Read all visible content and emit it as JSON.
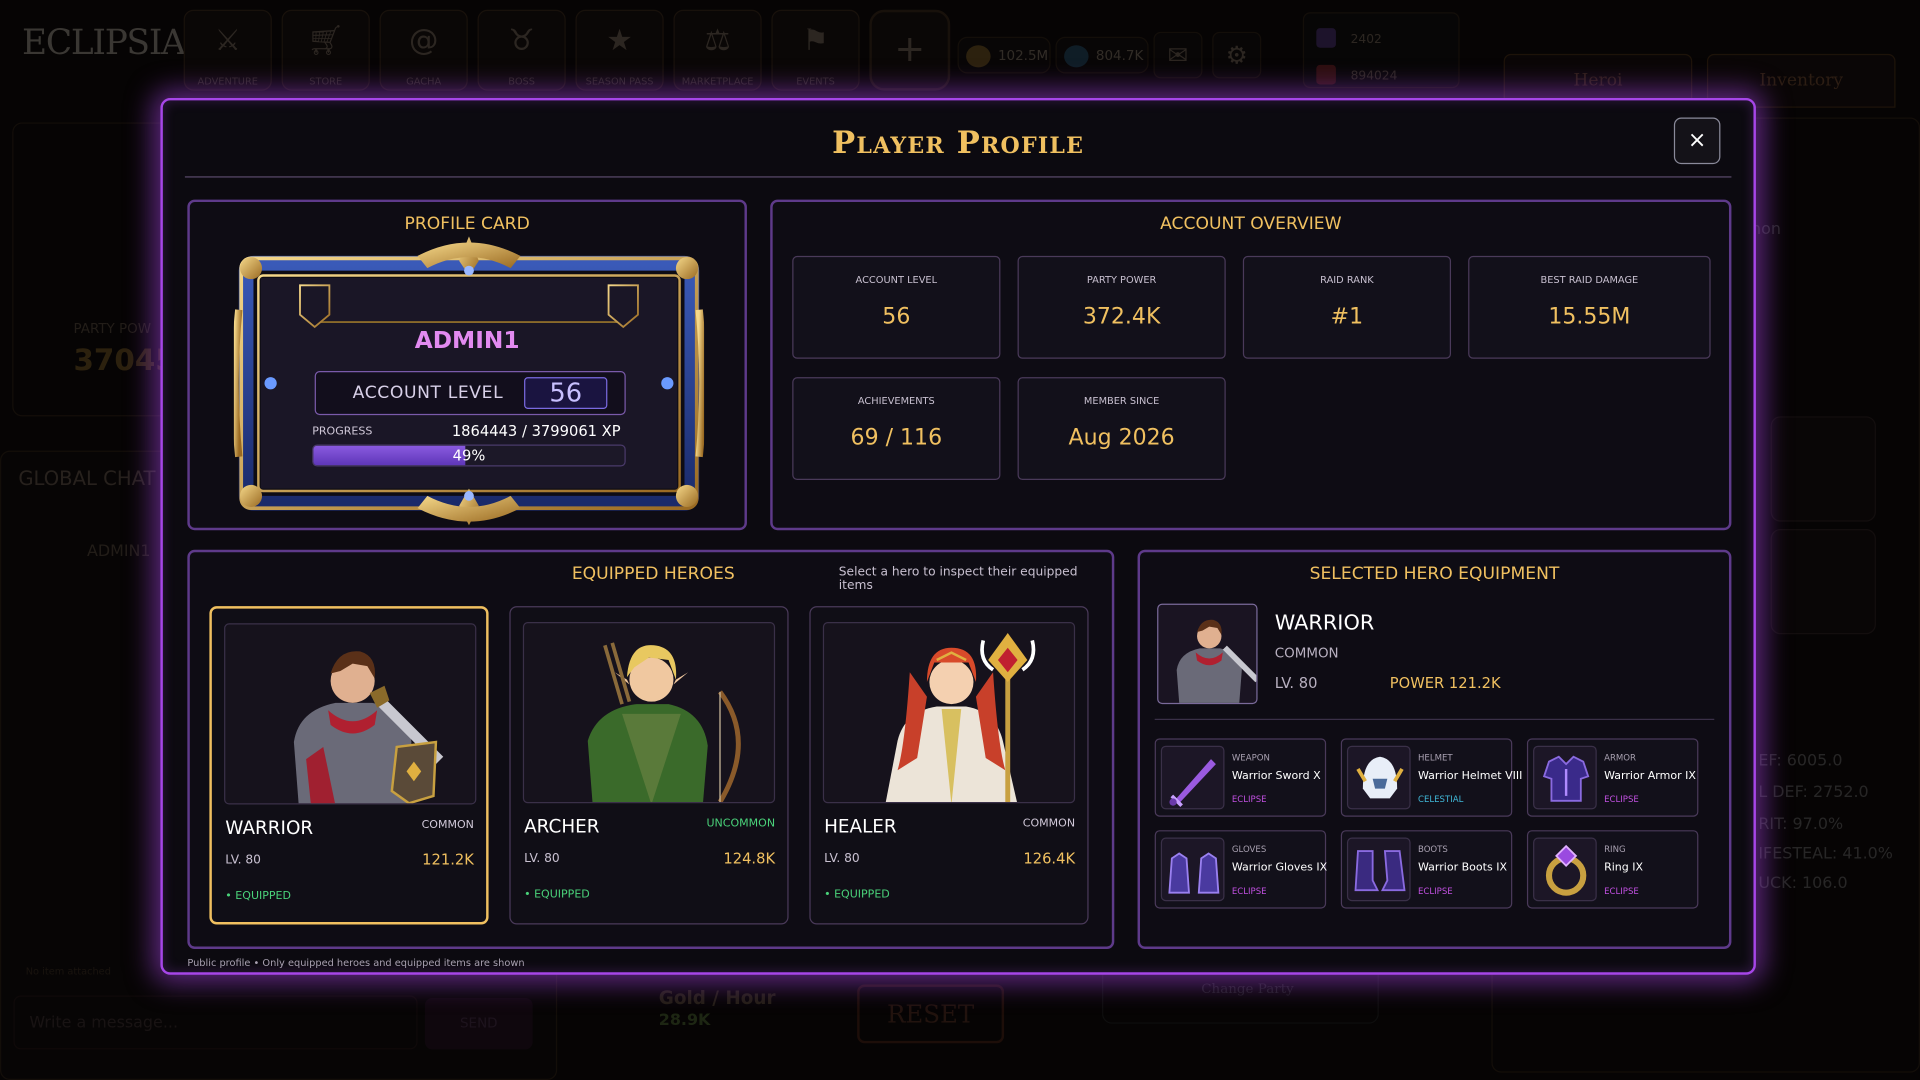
{
  "background": {
    "logo": "ECLIPSIA",
    "nav": [
      {
        "label": "ADVENTURE",
        "icon": "crossed-swords-icon"
      },
      {
        "label": "STORE",
        "icon": "cart-icon"
      },
      {
        "label": "GACHA",
        "icon": "swirl-icon"
      },
      {
        "label": "BOSS",
        "icon": "horned-helmet-icon"
      },
      {
        "label": "SEASON PASS",
        "icon": "star-shield-icon"
      },
      {
        "label": "MARKETPLACE",
        "icon": "scales-icon"
      },
      {
        "label": "EVENTS",
        "icon": "banner-icon"
      }
    ],
    "plus": "+",
    "gold": "102.5M",
    "fish": "804.7K",
    "gems": "2402",
    "rubies": "894024",
    "tab_heroes": "Heroi",
    "tab_inventory": "Inventory",
    "party_power_label": "PARTY POW",
    "party_power_value": "37045",
    "chat_title": "GLOBAL CHAT",
    "chat_user": "ADMIN1",
    "chat_attach": "No item attached",
    "chat_placeholder": "Write a message...",
    "chat_send": "SEND",
    "gold_hour_label": "Gold / Hour",
    "gold_hour_value": "28.9K",
    "reset": "RESET",
    "change_party": "Change Party",
    "stats": [
      "EF: 6005.0",
      "L DEF: 2752.0",
      "RIT: 97.0%",
      "IFESTEAL: 41.0%",
      "UCK: 106.0"
    ],
    "summon_frag": "non"
  },
  "modal": {
    "title": "Player Profile",
    "close": "×",
    "footnote": "Public profile • Only equipped heroes and equipped items are shown"
  },
  "profile_card": {
    "title": "PROFILE CARD",
    "name": "ADMIN1",
    "level_label": "ACCOUNT LEVEL",
    "level": "56",
    "progress_label": "PROGRESS",
    "progress_xp": "1864443 / 3799061 XP",
    "progress_pct_text": "49%",
    "progress_fraction": 0.49
  },
  "overview": {
    "title": "ACCOUNT OVERVIEW",
    "stats": [
      {
        "label": "ACCOUNT LEVEL",
        "value": "56"
      },
      {
        "label": "PARTY POWER",
        "value": "372.4K"
      },
      {
        "label": "RAID RANK",
        "value": "#1"
      },
      {
        "label": "BEST RAID DAMAGE",
        "value": "15.55M"
      },
      {
        "label": "ACHIEVEMENTS",
        "value": "69 / 116"
      },
      {
        "label": "MEMBER SINCE",
        "value": "Aug 2026"
      }
    ]
  },
  "heroes": {
    "title": "EQUIPPED HEROES",
    "subtitle": "Select a hero to inspect their equipped items",
    "list": [
      {
        "name": "WARRIOR",
        "rarity": "COMMON",
        "rarity_color": "#d0c8d8",
        "level": "LV. 80",
        "power": "121.2K",
        "status": "• EQUIPPED"
      },
      {
        "name": "ARCHER",
        "rarity": "UNCOMMON",
        "rarity_color": "#4ad27a",
        "level": "LV. 80",
        "power": "124.8K",
        "status": "• EQUIPPED"
      },
      {
        "name": "HEALER",
        "rarity": "COMMON",
        "rarity_color": "#d0c8d8",
        "level": "LV. 80",
        "power": "126.4K",
        "status": "• EQUIPPED"
      }
    ]
  },
  "equipment": {
    "title": "SELECTED HERO EQUIPMENT",
    "hero_name": "WARRIOR",
    "hero_rarity": "COMMON",
    "hero_level": "LV. 80",
    "hero_power": "POWER 121.2K",
    "items": [
      {
        "slot": "WEAPON",
        "name": "Warrior Sword X",
        "rarity": "ECLIPSE",
        "rarity_color": "#c050e0",
        "icon": "sword-icon"
      },
      {
        "slot": "HELMET",
        "name": "Warrior Helmet VIII",
        "rarity": "CELESTIAL",
        "rarity_color": "#40b8d8",
        "icon": "helmet-icon"
      },
      {
        "slot": "ARMOR",
        "name": "Warrior Armor IX",
        "rarity": "ECLIPSE",
        "rarity_color": "#c050e0",
        "icon": "armor-icon"
      },
      {
        "slot": "GLOVES",
        "name": "Warrior Gloves IX",
        "rarity": "ECLIPSE",
        "rarity_color": "#c050e0",
        "icon": "gloves-icon"
      },
      {
        "slot": "BOOTS",
        "name": "Warrior Boots IX",
        "rarity": "ECLIPSE",
        "rarity_color": "#c050e0",
        "icon": "boots-icon"
      },
      {
        "slot": "RING",
        "name": "Ring IX",
        "rarity": "ECLIPSE",
        "rarity_color": "#c050e0",
        "icon": "ring-icon"
      }
    ]
  },
  "colors": {
    "accent": "#a646e8",
    "gold": "#f0c060",
    "equipped": "#4ad27a"
  }
}
